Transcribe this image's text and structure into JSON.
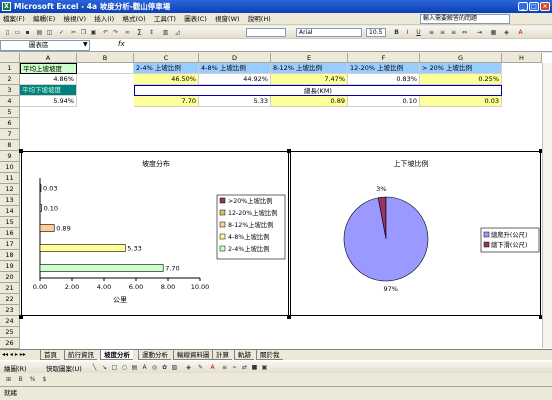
{
  "window": {
    "title": "Microsoft Excel - 4a 坡度分析-觀山停車場"
  },
  "menu": {
    "items": [
      "檔案(F)",
      "編輯(E)",
      "檢視(V)",
      "插入(I)",
      "格式(O)",
      "工具(T)",
      "圖表(C)",
      "視窗(W)",
      "說明(H)"
    ],
    "help_placeholder": "輸入需要解答的問題"
  },
  "toolbar": {
    "font": "Arial",
    "size": "10.5",
    "sigma": "Σ"
  },
  "formula_bar": {
    "name_box": "圖表區",
    "fx": "fx"
  },
  "columns": [
    "A",
    "B",
    "C",
    "D",
    "E",
    "F",
    "G",
    "H"
  ],
  "rows": [
    "1",
    "2",
    "3",
    "4",
    "5",
    "6",
    "7",
    "8",
    "9",
    "10",
    "11",
    "12",
    "13",
    "14",
    "15",
    "16",
    "17",
    "18",
    "19",
    "20",
    "21",
    "22",
    "23",
    "24",
    "25",
    "26",
    "27"
  ],
  "cells": {
    "a1": "平均上坡坡度",
    "a2": "4.86%",
    "a3": "平均下坡坡度",
    "a4": "5.94%",
    "c1": "2-4% 上坡比例",
    "d1": "4-8% 上坡比例",
    "e1": "8-12% 上坡比例",
    "f1": "12-20% 上坡比例",
    "g1": "> 20% 上坡比例",
    "c2": "46.50%",
    "d2": "44.92%",
    "e2": "7.47%",
    "f2": "0.83%",
    "g2": "0.25%",
    "e3": "總長(KM)",
    "c4": "7.70",
    "d4": "5.33",
    "e4": "0.89",
    "f4": "0.10",
    "g4": "0.03"
  },
  "chart_data": [
    {
      "type": "bar",
      "title": "坡度分布",
      "xlabel": "公里",
      "categories": [
        "2-4%上坡比例",
        "4-8%上坡比例",
        "8-12%上坡比例",
        "12-20%上坡比例",
        ">20%上坡比例"
      ],
      "values": [
        7.7,
        5.33,
        0.89,
        0.1,
        0.03
      ],
      "data_labels": [
        "7.70",
        "5.33",
        "0.89",
        "0.10",
        "0.03"
      ],
      "colors": [
        "#ccffcc",
        "#ffff99",
        "#ffcc99",
        "#cccc66",
        "#993366"
      ],
      "xlim": [
        0,
        10
      ],
      "xticks": [
        "0.00",
        "2.00",
        "4.00",
        "6.00",
        "8.00",
        "10.00"
      ],
      "legend": [
        ">20%上坡比例",
        "12-20%上坡比例",
        "8-12%上坡比例",
        "4-8%上坡比例",
        "2-4%上坡比例"
      ],
      "legend_placement": "right"
    },
    {
      "type": "pie",
      "title": "上下坡比例",
      "categories": [
        "總爬升(公尺)",
        "總下滑(公尺)"
      ],
      "values": [
        97,
        3
      ],
      "data_labels": [
        "97%",
        "3%"
      ],
      "colors": [
        "#9999ff",
        "#993366"
      ],
      "legend_placement": "right"
    }
  ],
  "sheet_tabs": [
    "首頁",
    "航行資訊",
    "坡度分析",
    "運動分析",
    "輸線資料圖",
    "計算",
    "軌跡",
    "關於我"
  ],
  "drawbar": {
    "draw": "繪圖(R)",
    "autoshapes": "快取圖案(U)"
  },
  "status": {
    "text": "就緒"
  }
}
